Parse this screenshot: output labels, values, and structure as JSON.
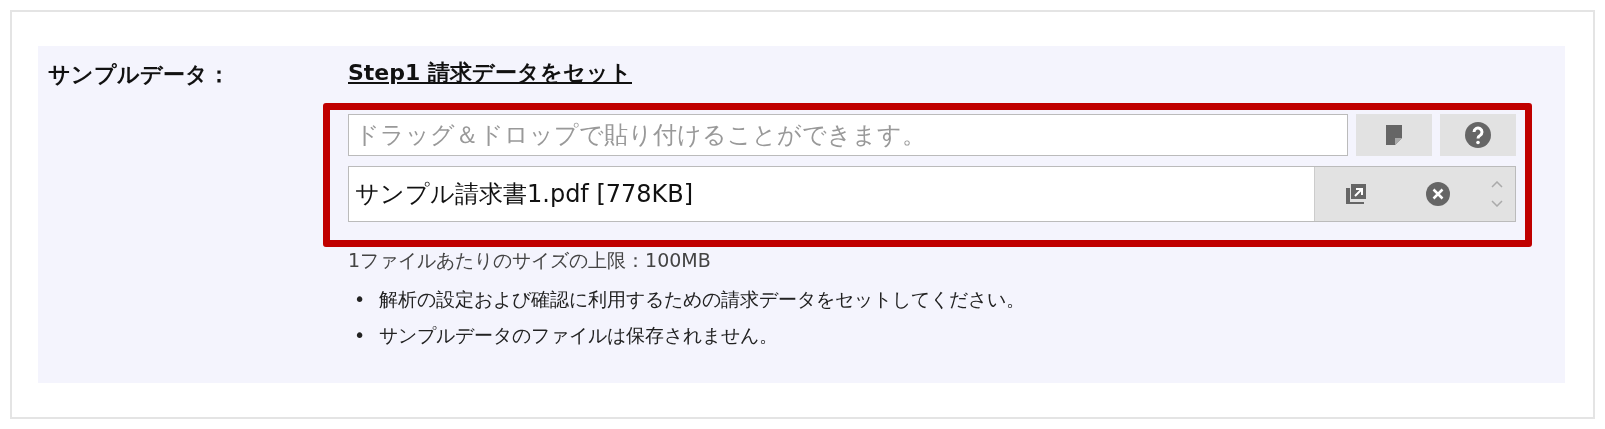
{
  "field_label": "サンプルデータ：",
  "step_title": "Step1 請求データをセット",
  "drop_field": {
    "placeholder": "ドラッグ＆ドロップで貼り付けることができます。"
  },
  "file_field": {
    "value": "サンプル請求書1.pdf [778KB]"
  },
  "size_limit": "1ファイルあたりのサイズの上限：100MB",
  "notes": [
    {
      "marker": "•",
      "text": "解析の設定および確認に利用するための請求データをセットしてください。"
    },
    {
      "marker": "•",
      "text": "サンプルデータのファイルは保存されません。"
    }
  ]
}
